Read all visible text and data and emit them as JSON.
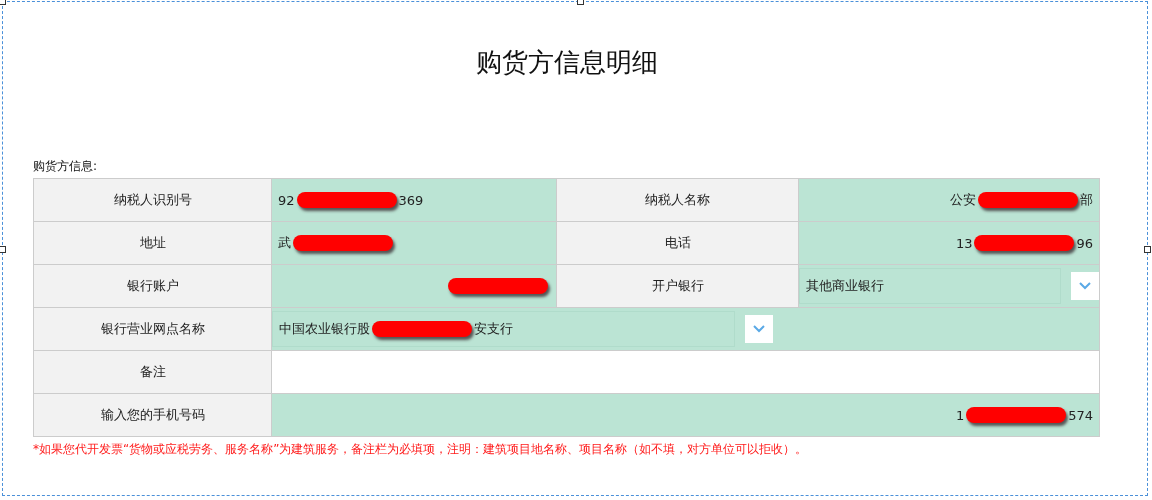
{
  "title": "购货方信息明细",
  "section_label": "购货方信息:",
  "rows": [
    {
      "fields": [
        {
          "label": "纳税人识别号",
          "kind": "left",
          "start": "92",
          "end": "369",
          "redacted": true
        },
        {
          "label": "纳税人名称",
          "kind": "right",
          "start": "公安",
          "end": "部",
          "redacted": true
        }
      ]
    },
    {
      "fields": [
        {
          "label": "地址",
          "kind": "left",
          "start": "武",
          "redacted": true
        },
        {
          "label": "电话",
          "kind": "right",
          "start": "13",
          "end": "96",
          "redacted": true
        }
      ]
    },
    {
      "fields": [
        {
          "label": "银行账户",
          "kind": "right",
          "redacted": true
        },
        {
          "label": "开户银行",
          "kind": "select",
          "start": "其他商业银行"
        }
      ]
    },
    {
      "fields": [
        {
          "label": "银行营业网点名称",
          "kind": "select",
          "start": "中国农业银行股",
          "end": "安支行",
          "redacted": true
        }
      ]
    },
    {
      "fields": [
        {
          "label": "备注",
          "kind": "empty"
        }
      ]
    },
    {
      "fields": [
        {
          "label": "输入您的手机号码",
          "kind": "right",
          "start": "1",
          "end": "574",
          "redacted": true
        }
      ]
    }
  ],
  "note": "*如果您代开发票“货物或应税劳务、服务名称”为建筑服务，备注栏为必填项，注明：建筑项目地名称、项目名称（如不填，对方单位可以拒收）。"
}
